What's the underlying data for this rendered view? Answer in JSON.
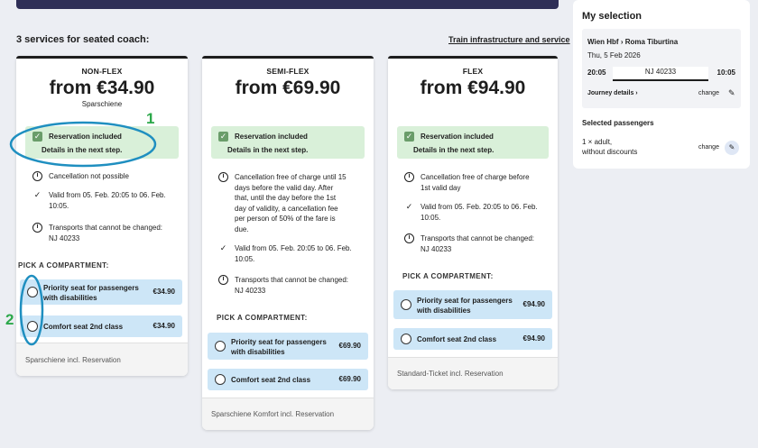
{
  "header": {
    "services_heading": "3 services for seated coach:",
    "infra_link": "Train infrastructure and service"
  },
  "cards": [
    {
      "tier": "NON-FLEX",
      "price": "from €34.90",
      "subname": "Sparschiene",
      "reservation_l1": "Reservation included",
      "reservation_l2": "Details in the next step.",
      "features": [
        {
          "icon": "info-icon",
          "text": "Cancellation not possible"
        },
        {
          "icon": "check-icon",
          "text": "Valid from 05. Feb. 20:05 to 06. Feb.\n10:05."
        },
        {
          "icon": "info-icon",
          "text": "Transports that cannot be changed:\nNJ 40233"
        }
      ],
      "pick_label": "PICK A COMPARTMENT:",
      "seats": [
        {
          "name": "Priority seat for passengers\nwith disabilities",
          "price": "€34.90"
        },
        {
          "name": "Comfort seat 2nd class",
          "price": "€34.90"
        }
      ],
      "footer": "Sparschiene incl. Reservation"
    },
    {
      "tier": "SEMI-FLEX",
      "price": "from €69.90",
      "subname": "",
      "reservation_l1": "Reservation included",
      "reservation_l2": "Details in the next step.",
      "features": [
        {
          "icon": "info-icon",
          "text": "Cancellation free of charge until 15\ndays before the valid day. After\nthat, until the day before the 1st\nday of validity, a cancellation fee\nper person of 50% of the fare is\ndue."
        },
        {
          "icon": "check-icon",
          "text": "Valid from 05. Feb. 20:05 to 06. Feb.\n10:05."
        },
        {
          "icon": "info-icon",
          "text": "Transports that cannot be changed:\nNJ 40233"
        }
      ],
      "pick_label": "PICK A COMPARTMENT:",
      "seats": [
        {
          "name": "Priority seat for passengers\nwith disabilities",
          "price": "€69.90"
        },
        {
          "name": "Comfort seat 2nd class",
          "price": "€69.90"
        }
      ],
      "footer": "Sparschiene Komfort incl. Reservation"
    },
    {
      "tier": "FLEX",
      "price": "from €94.90",
      "subname": "",
      "reservation_l1": "Reservation included",
      "reservation_l2": "Details in the next step.",
      "features": [
        {
          "icon": "info-icon",
          "text": "Cancellation free of charge before\n1st valid day"
        },
        {
          "icon": "check-icon",
          "text": "Valid from 05. Feb. 20:05 to 06. Feb.\n10:05."
        },
        {
          "icon": "info-icon",
          "text": "Transports that cannot be changed:\nNJ 40233"
        }
      ],
      "pick_label": "PICK A COMPARTMENT:",
      "seats": [
        {
          "name": "Priority seat for passengers\nwith disabilities",
          "price": "€94.90"
        },
        {
          "name": "Comfort seat 2nd class",
          "price": "€94.90"
        }
      ],
      "footer": "Standard-Ticket incl. Reservation"
    }
  ],
  "selection": {
    "title": "My selection",
    "route": "Wien Hbf › Roma Tiburtina",
    "date": "Thu, 5 Feb 2026",
    "departure": "20:05",
    "train": "NJ 40233",
    "arrival": "10:05",
    "journey_details": "Journey details ›",
    "change_label": "change",
    "passengers_title": "Selected passengers",
    "passengers_text": "1 × adult,\nwithout discounts"
  },
  "annotations": {
    "marker_1": "1",
    "marker_2": "2",
    "accent_color": "#1f8fc0",
    "marker_color": "#2ca84a"
  }
}
